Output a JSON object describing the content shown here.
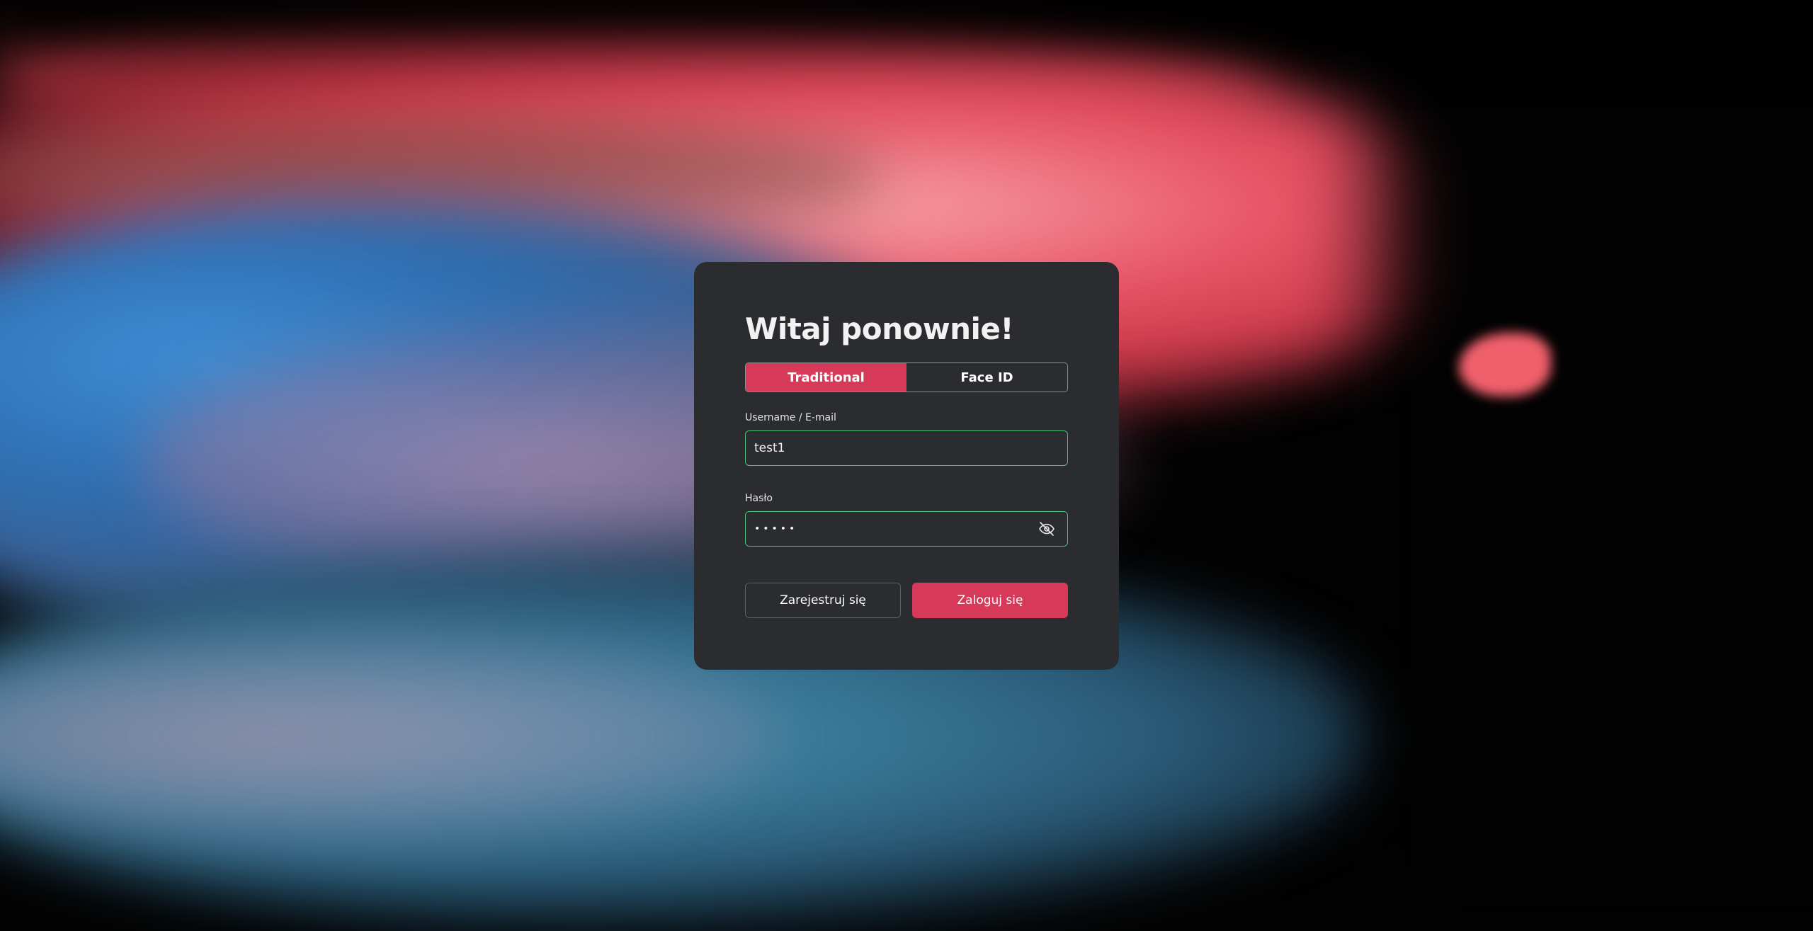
{
  "login": {
    "title": "Witaj ponownie!",
    "tabs": [
      {
        "label": "Traditional",
        "active": true
      },
      {
        "label": "Face ID",
        "active": false
      }
    ],
    "username": {
      "label": "Username / E-mail",
      "value": "test1"
    },
    "password": {
      "label": "Hasło",
      "masked_value": "•••••",
      "toggle_icon": "eye-off-icon"
    },
    "register_label": "Zarejestruj się",
    "login_label": "Zaloguj się"
  },
  "colors": {
    "accent": "#d63a58",
    "card_background": "#2a2c2f",
    "input_border_valid": "#4fbf7a"
  }
}
